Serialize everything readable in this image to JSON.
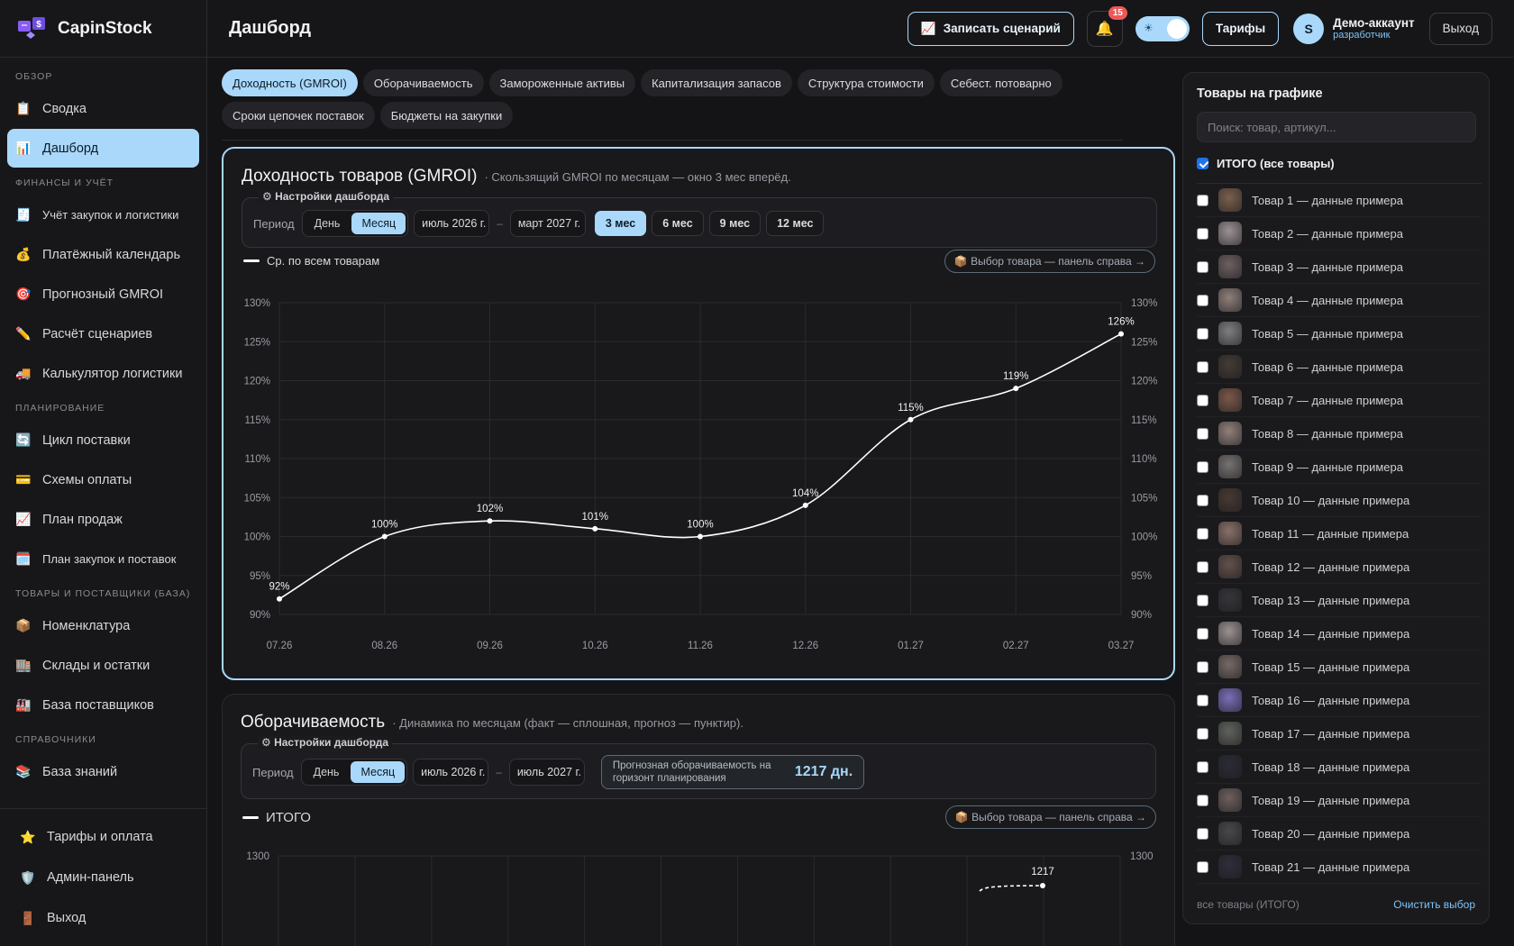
{
  "brand": {
    "name": "CapinStock"
  },
  "sidebar": {
    "sections": [
      {
        "title": "ОБЗОР",
        "items": [
          {
            "icon": "📋",
            "label": "Сводка"
          },
          {
            "icon": "📊",
            "label": "Дашборд",
            "active": true
          }
        ]
      },
      {
        "title": "ФИНАНСЫ И УЧЁТ",
        "items": [
          {
            "icon": "🧾",
            "label": "Учёт закупок и логистики",
            "small": true
          },
          {
            "icon": "💰",
            "label": "Платёжный календарь"
          },
          {
            "icon": "🎯",
            "label": "Прогнозный GMROI"
          },
          {
            "icon": "✏️",
            "label": "Расчёт сценариев"
          },
          {
            "icon": "🚚",
            "label": "Калькулятор логистики"
          }
        ]
      },
      {
        "title": "ПЛАНИРОВАНИЕ",
        "items": [
          {
            "icon": "🔄",
            "label": "Цикл поставки"
          },
          {
            "icon": "💳",
            "label": "Схемы оплаты"
          },
          {
            "icon": "📈",
            "label": "План продаж"
          },
          {
            "icon": "🗓️",
            "label": "План закупок и поставок",
            "small": true
          }
        ]
      },
      {
        "title": "ТОВАРЫ И ПОСТАВЩИКИ (БАЗА)",
        "items": [
          {
            "icon": "📦",
            "label": "Номенклатура"
          },
          {
            "icon": "🏬",
            "label": "Склады и остатки"
          },
          {
            "icon": "🏭",
            "label": "База поставщиков"
          }
        ]
      },
      {
        "title": "СПРАВОЧНИКИ",
        "items": [
          {
            "icon": "📚",
            "label": "База знаний"
          }
        ]
      }
    ],
    "bottom": [
      {
        "icon": "⭐",
        "label": "Тарифы и оплата"
      },
      {
        "icon": "🛡️",
        "label": "Админ-панель"
      },
      {
        "icon": "🚪",
        "label": "Выход"
      }
    ]
  },
  "header": {
    "title": "Дашборд",
    "record_label": "Записать сценарий",
    "record_icon": "📈",
    "notif_count": "15",
    "plans_label": "Тарифы",
    "user_initial": "S",
    "user_name": "Демо-аккаунт",
    "user_role": "разработчик",
    "logout_label": "Выход"
  },
  "tabs": [
    {
      "label": "Доходность (GMROI)",
      "active": true
    },
    {
      "label": "Оборачиваемость"
    },
    {
      "label": "Замороженные активы"
    },
    {
      "label": "Капитализация запасов"
    },
    {
      "label": "Структура стоимости"
    },
    {
      "label": "Себест. потоварно"
    },
    {
      "label": "Сроки цепочек поставок"
    },
    {
      "label": "Бюджеты на закупки"
    }
  ],
  "gmroi": {
    "title": "Доходность товаров (GMROI)",
    "subtitle": "· Скользящий GMROI по месяцам — окно 3 мес вперёд.",
    "settings_label": "⚙ Настройки дашборда",
    "period_label": "Период",
    "seg_day": "День",
    "seg_month": "Месяц",
    "date_from": "июль 2026 г.",
    "date_to": "март 2027 г.",
    "dash": "–",
    "windows": [
      {
        "label": "3 мес",
        "active": true
      },
      {
        "label": "6 мес"
      },
      {
        "label": "9 мес"
      },
      {
        "label": "12 мес"
      }
    ],
    "legend": "Ср. по всем товарам",
    "pick_label": "📦 Выбор товара — панель справа →"
  },
  "chart_data": [
    {
      "type": "line",
      "x": [
        "07.26",
        "08.26",
        "09.26",
        "10.26",
        "11.26",
        "12.26",
        "01.27",
        "02.27",
        "03.27"
      ],
      "series": [
        {
          "name": "Ср. по всем товарам",
          "values": [
            92,
            100,
            102,
            101,
            100,
            104,
            115,
            119,
            126
          ],
          "labels": [
            "92%",
            "100%",
            "102%",
            "101%",
            "100%",
            "104%",
            "115%",
            "119%",
            "126%"
          ]
        }
      ],
      "ylim": [
        90,
        130
      ],
      "yticks": [
        "90%",
        "95%",
        "100%",
        "105%",
        "110%",
        "115%",
        "120%",
        "125%",
        "130%"
      ],
      "grid": true,
      "color": "#ffffff"
    },
    {
      "type": "line",
      "series": [
        {
          "name": "ИТОГО",
          "values": [],
          "labels": [
            "1217"
          ]
        }
      ],
      "yticks": [
        "1300"
      ],
      "grid": true
    }
  ],
  "turnover": {
    "title": "Оборачиваемость",
    "subtitle": "· Динамика по месяцам (факт — сплошная, прогноз — пунктир).",
    "settings_label": "⚙ Настройки дашборда",
    "period_label": "Период",
    "seg_day": "День",
    "seg_month": "Месяц",
    "date_from": "июль 2026 г.",
    "date_to": "июль 2027 г.",
    "dash": "–",
    "forecast_label": "Прогнозная оборачиваемость на горизонт планирования",
    "forecast_value": "1217 дн.",
    "legend": "ИТОГО",
    "pick_label": "📦 Выбор товара — панель справа →"
  },
  "right_panel": {
    "title": "Товары на графике",
    "search_placeholder": "Поиск: товар, артикул...",
    "total_label": "ИТОГО (все товары)",
    "items": [
      {
        "label": "Товар 1 — данные примера",
        "color": "#8a6a55"
      },
      {
        "label": "Товар 2 — данные примера",
        "color": "#b0a4a6"
      },
      {
        "label": "Товар 3 — данные примера",
        "color": "#7a6b6a"
      },
      {
        "label": "Товар 4 — данные примера",
        "color": "#a08f88"
      },
      {
        "label": "Товар 5 — данные примера",
        "color": "#8e8e92"
      },
      {
        "label": "Товар 6 — данные примера",
        "color": "#4a4038"
      },
      {
        "label": "Товар 7 — данные примера",
        "color": "#8a6150"
      },
      {
        "label": "Товар 8 — данные примера",
        "color": "#a49088"
      },
      {
        "label": "Товар 9 — данные примера",
        "color": "#85807e"
      },
      {
        "label": "Товар 10 — данные примера",
        "color": "#4e3e36"
      },
      {
        "label": "Товар 11 — данные примера",
        "color": "#9a7e74"
      },
      {
        "label": "Товар 12 — данные примера",
        "color": "#6e5a52"
      },
      {
        "label": "Товар 13 — данные примера",
        "color": "#3a3a3e"
      },
      {
        "label": "Товар 14 — данные примера",
        "color": "#b0a4a2"
      },
      {
        "label": "Товар 15 — данные примера",
        "color": "#857670"
      },
      {
        "label": "Товар 16 — данные примера",
        "color": "#8a7ad0"
      },
      {
        "label": "Товар 17 — данные примера",
        "color": "#6a6e66"
      },
      {
        "label": "Товар 18 — данные примера",
        "color": "#2e2e3a"
      },
      {
        "label": "Товар 19 — данные примера",
        "color": "#7a6a66"
      },
      {
        "label": "Товар 20 — данные примера",
        "color": "#505054"
      },
      {
        "label": "Товар 21 — данные примера",
        "color": "#33303e"
      }
    ],
    "footer_left": "все товары (ИТОГО)",
    "footer_right": "Очистить выбор"
  }
}
